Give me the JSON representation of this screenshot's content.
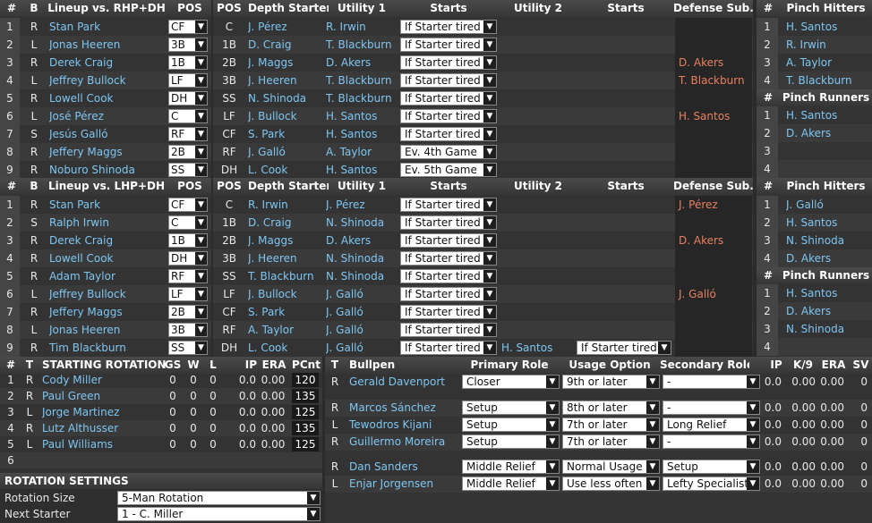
{
  "rhp": {
    "title": "Lineup vs. RHP+DH",
    "headers": {
      "num": "#",
      "bats": "B",
      "pos": "POS",
      "depth_pos": "POS",
      "depth_starter": "Depth Starter",
      "utility1": "Utility 1",
      "starts": "Starts",
      "utility2": "Utility 2",
      "starts2": "Starts",
      "defsub": "Defense Sub."
    },
    "lineup": [
      {
        "n": "1",
        "b": "R",
        "name": "Stan Park",
        "pos": "CF"
      },
      {
        "n": "2",
        "b": "L",
        "name": "Jonas Heeren",
        "pos": "3B"
      },
      {
        "n": "3",
        "b": "R",
        "name": "Derek Craig",
        "pos": "1B"
      },
      {
        "n": "4",
        "b": "L",
        "name": "Jeffrey Bullock",
        "pos": "LF"
      },
      {
        "n": "5",
        "b": "R",
        "name": "Lowell Cook",
        "pos": "DH"
      },
      {
        "n": "6",
        "b": "L",
        "name": "José Pérez",
        "pos": "C"
      },
      {
        "n": "7",
        "b": "S",
        "name": "Jesús Galló",
        "pos": "RF"
      },
      {
        "n": "8",
        "b": "R",
        "name": "Jeffery Maggs",
        "pos": "2B"
      },
      {
        "n": "9",
        "b": "R",
        "name": "Noburo Shinoda",
        "pos": "SS"
      }
    ],
    "depth": [
      {
        "pos": "C",
        "starter": "J. Pérez",
        "u1": "R. Irwin",
        "starts": "If Starter tired",
        "u2": "",
        "starts2": "",
        "def": ""
      },
      {
        "pos": "1B",
        "starter": "D. Craig",
        "u1": "T. Blackburn",
        "starts": "If Starter tired",
        "u2": "",
        "starts2": "",
        "def": ""
      },
      {
        "pos": "2B",
        "starter": "J. Maggs",
        "u1": "D. Akers",
        "starts": "If Starter tired",
        "u2": "",
        "starts2": "",
        "def": "D. Akers"
      },
      {
        "pos": "3B",
        "starter": "J. Heeren",
        "u1": "T. Blackburn",
        "starts": "If Starter tired",
        "u2": "",
        "starts2": "",
        "def": "T. Blackburn"
      },
      {
        "pos": "SS",
        "starter": "N. Shinoda",
        "u1": "T. Blackburn",
        "starts": "If Starter tired",
        "u2": "",
        "starts2": "",
        "def": ""
      },
      {
        "pos": "LF",
        "starter": "J. Bullock",
        "u1": "H. Santos",
        "starts": "If Starter tired",
        "u2": "",
        "starts2": "",
        "def": "H. Santos"
      },
      {
        "pos": "CF",
        "starter": "S. Park",
        "u1": "H. Santos",
        "starts": "If Starter tired",
        "u2": "",
        "starts2": "",
        "def": ""
      },
      {
        "pos": "RF",
        "starter": "J. Galló",
        "u1": "A. Taylor",
        "starts": "Ev. 4th Game",
        "u2": "",
        "starts2": "",
        "def": ""
      },
      {
        "pos": "DH",
        "starter": "L. Cook",
        "u1": "H. Santos",
        "starts": "Ev. 5th Game",
        "u2": "",
        "starts2": "",
        "def": ""
      }
    ],
    "ph_title": "Pinch Hitters",
    "pinch_hitters": [
      {
        "n": "1",
        "name": "H. Santos"
      },
      {
        "n": "2",
        "name": "R. Irwin"
      },
      {
        "n": "3",
        "name": "A. Taylor"
      },
      {
        "n": "4",
        "name": "T. Blackburn"
      }
    ],
    "pr_title": "Pinch Runners",
    "pinch_runners": [
      {
        "n": "1",
        "name": "H. Santos"
      },
      {
        "n": "2",
        "name": "D. Akers"
      },
      {
        "n": "3",
        "name": ""
      },
      {
        "n": "4",
        "name": ""
      }
    ]
  },
  "lhp": {
    "title": "Lineup vs. LHP+DH",
    "lineup": [
      {
        "n": "1",
        "b": "R",
        "name": "Stan Park",
        "pos": "CF"
      },
      {
        "n": "2",
        "b": "S",
        "name": "Ralph Irwin",
        "pos": "C"
      },
      {
        "n": "3",
        "b": "R",
        "name": "Derek Craig",
        "pos": "1B"
      },
      {
        "n": "4",
        "b": "R",
        "name": "Lowell Cook",
        "pos": "DH"
      },
      {
        "n": "5",
        "b": "R",
        "name": "Adam Taylor",
        "pos": "RF"
      },
      {
        "n": "6",
        "b": "L",
        "name": "Jeffrey Bullock",
        "pos": "LF"
      },
      {
        "n": "7",
        "b": "R",
        "name": "Jeffery Maggs",
        "pos": "2B"
      },
      {
        "n": "8",
        "b": "L",
        "name": "Jonas Heeren",
        "pos": "3B"
      },
      {
        "n": "9",
        "b": "R",
        "name": "Tim Blackburn",
        "pos": "SS"
      }
    ],
    "depth": [
      {
        "pos": "C",
        "starter": "R. Irwin",
        "u1": "J. Pérez",
        "starts": "If Starter tired",
        "u2": "",
        "starts2": "",
        "def": "J. Pérez"
      },
      {
        "pos": "1B",
        "starter": "D. Craig",
        "u1": "N. Shinoda",
        "starts": "If Starter tired",
        "u2": "",
        "starts2": "",
        "def": ""
      },
      {
        "pos": "2B",
        "starter": "J. Maggs",
        "u1": "D. Akers",
        "starts": "If Starter tired",
        "u2": "",
        "starts2": "",
        "def": "D. Akers"
      },
      {
        "pos": "3B",
        "starter": "J. Heeren",
        "u1": "N. Shinoda",
        "starts": "If Starter tired",
        "u2": "",
        "starts2": "",
        "def": ""
      },
      {
        "pos": "SS",
        "starter": "T. Blackburn",
        "u1": "N. Shinoda",
        "starts": "If Starter tired",
        "u2": "",
        "starts2": "",
        "def": ""
      },
      {
        "pos": "LF",
        "starter": "J. Bullock",
        "u1": "J. Galló",
        "starts": "If Starter tired",
        "u2": "",
        "starts2": "",
        "def": "J. Galló"
      },
      {
        "pos": "CF",
        "starter": "S. Park",
        "u1": "J. Galló",
        "starts": "If Starter tired",
        "u2": "",
        "starts2": "",
        "def": ""
      },
      {
        "pos": "RF",
        "starter": "A. Taylor",
        "u1": "J. Galló",
        "starts": "If Starter tired",
        "u2": "",
        "starts2": "",
        "def": ""
      },
      {
        "pos": "DH",
        "starter": "L. Cook",
        "u1": "J. Galló",
        "starts": "If Starter tired",
        "u2": "H. Santos",
        "starts2": "If Starter tired",
        "def": ""
      }
    ],
    "ph_title": "Pinch Hitters",
    "pinch_hitters": [
      {
        "n": "1",
        "name": "J. Galló"
      },
      {
        "n": "2",
        "name": "H. Santos"
      },
      {
        "n": "3",
        "name": "N. Shinoda"
      },
      {
        "n": "4",
        "name": "D. Akers"
      }
    ],
    "pr_title": "Pinch Runners",
    "pinch_runners": [
      {
        "n": "1",
        "name": "H. Santos"
      },
      {
        "n": "2",
        "name": "D. Akers"
      },
      {
        "n": "3",
        "name": "N. Shinoda"
      },
      {
        "n": "4",
        "name": ""
      }
    ]
  },
  "rotation": {
    "headers": {
      "num": "#",
      "t": "T",
      "title": "STARTING ROTATION",
      "gs": "GS",
      "w": "W",
      "l": "L",
      "ip": "IP",
      "era": "ERA",
      "pcnt": "PCnt"
    },
    "rows": [
      {
        "n": "1",
        "t": "R",
        "name": "Cody Miller",
        "gs": "0",
        "w": "0",
        "l": "0",
        "ip": "0.0",
        "era": "0.00",
        "pcnt": "120"
      },
      {
        "n": "2",
        "t": "R",
        "name": "Paul Green",
        "gs": "0",
        "w": "0",
        "l": "0",
        "ip": "0.0",
        "era": "0.00",
        "pcnt": "135"
      },
      {
        "n": "3",
        "t": "L",
        "name": "Jorge Martinez",
        "gs": "0",
        "w": "0",
        "l": "0",
        "ip": "0.0",
        "era": "0.00",
        "pcnt": "125"
      },
      {
        "n": "4",
        "t": "R",
        "name": "Lutz Althusser",
        "gs": "0",
        "w": "0",
        "l": "0",
        "ip": "0.0",
        "era": "0.00",
        "pcnt": "135"
      },
      {
        "n": "5",
        "t": "L",
        "name": "Paul Williams",
        "gs": "0",
        "w": "0",
        "l": "0",
        "ip": "0.0",
        "era": "0.00",
        "pcnt": "125"
      },
      {
        "n": "6",
        "t": "",
        "name": "",
        "gs": "",
        "w": "",
        "l": "",
        "ip": "",
        "era": "",
        "pcnt": ""
      }
    ]
  },
  "settings": {
    "title": "ROTATION SETTINGS",
    "size_label": "Rotation Size",
    "size_value": "5-Man Rotation",
    "next_label": "Next Starter",
    "next_value": "1 - C. Miller"
  },
  "bullpen": {
    "headers": {
      "t": "T",
      "title": "Bullpen",
      "primary": "Primary Role",
      "usage": "Usage Option",
      "secondary": "Secondary Role",
      "ip": "IP",
      "k9": "K/9",
      "era": "ERA",
      "sv": "SV"
    },
    "rows": [
      {
        "t": "R",
        "name": "Gerald Davenport",
        "primary": "Closer",
        "usage": "9th or later",
        "secondary": "-",
        "ip": "0.0",
        "k9": "0.00",
        "era": "0.00",
        "sv": "0"
      },
      {
        "t": "R",
        "name": "Marcos Sánchez",
        "primary": "Setup",
        "usage": "8th or later",
        "secondary": "-",
        "ip": "0.0",
        "k9": "0.00",
        "era": "0.00",
        "sv": "0"
      },
      {
        "t": "L",
        "name": "Tewodros Kijani",
        "primary": "Setup",
        "usage": "7th or later",
        "secondary": "Long Relief",
        "ip": "0.0",
        "k9": "0.00",
        "era": "0.00",
        "sv": "0"
      },
      {
        "t": "R",
        "name": "Guillermo Moreira",
        "primary": "Setup",
        "usage": "7th or later",
        "secondary": "-",
        "ip": "0.0",
        "k9": "0.00",
        "era": "0.00",
        "sv": "0"
      },
      {
        "t": "R",
        "name": "Dan Sanders",
        "primary": "Middle Relief",
        "usage": "Normal Usage",
        "secondary": "Setup",
        "ip": "0.0",
        "k9": "0.00",
        "era": "0.00",
        "sv": "0"
      },
      {
        "t": "L",
        "name": "Enjar Jorgensen",
        "primary": "Middle Relief",
        "usage": "Use less often",
        "secondary": "Lefty Specialist",
        "ip": "0.0",
        "k9": "0.00",
        "era": "0.00",
        "sv": "0"
      }
    ]
  },
  "icons": {
    "dropdown": "▼"
  }
}
